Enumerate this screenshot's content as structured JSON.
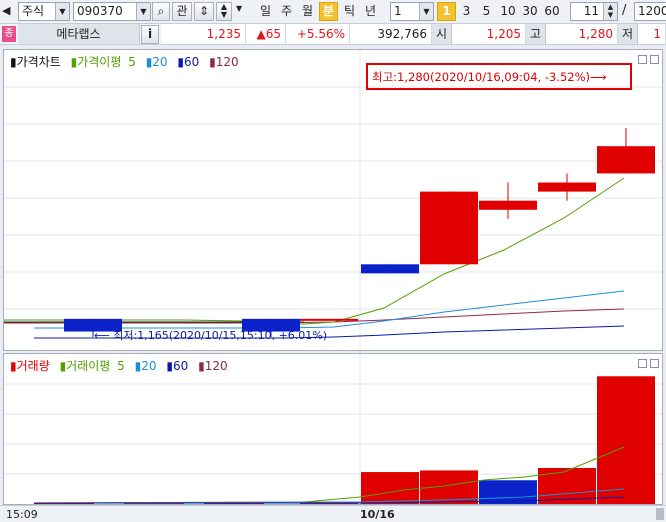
{
  "toolbar": {
    "market": "주식",
    "code": "090370",
    "search_label": "관",
    "periods": [
      "일",
      "주",
      "월",
      "분",
      "틱",
      "년"
    ],
    "active_period": "분",
    "interval_value": "1",
    "minute_options": [
      "1",
      "3",
      "5",
      "10",
      "30",
      "60"
    ],
    "active_minute": "1",
    "count_value": "11",
    "slash": "/",
    "total_count": "1200"
  },
  "info": {
    "logo_label": "종",
    "stock_name": "메타랩스",
    "info_button": "i",
    "price": "1,235",
    "change": "▲65",
    "change_pct": "+5.56%",
    "volume": "392,766",
    "open_label": "시",
    "open": "1,205",
    "high_label": "고",
    "high": "1,280",
    "low_label": "저",
    "low": "1"
  },
  "price_panel": {
    "legend_main": "가격차트",
    "legend_ma_label": "가격이평",
    "legend_periods": [
      "5",
      "20",
      "60",
      "120"
    ],
    "high_note": "최고:1,280(2020/10/16,09:04, -3.52%)⟶",
    "low_note": "⟵ 최저:1,165(2020/10/15,15:10, +6.01%)"
  },
  "volume_panel": {
    "legend_main": "거래량",
    "legend_ma_label": "거래이평",
    "legend_periods": [
      "5",
      "20",
      "60",
      "120"
    ]
  },
  "xaxis": {
    "labels": [
      "15:09",
      "10/16"
    ]
  },
  "colors": {
    "up": "#e00000",
    "down": "#0a22c8",
    "ma5": "#52a100",
    "ma20": "#1d8fd6",
    "ma60": "#0a1aa8",
    "ma120": "#8c2a4a",
    "note_border": "#e00000"
  },
  "chart_data": {
    "type": "candlestick",
    "price_candles": [
      {
        "open": 1175,
        "high": 1175,
        "low": 1165,
        "close": 1168
      },
      {
        "open": 1175,
        "high": 1175,
        "low": 1165,
        "close": 1168
      },
      {
        "open": 1175,
        "high": 1175,
        "low": 1175,
        "close": 1175
      },
      {
        "open": 1205,
        "high": 1205,
        "low": 1200,
        "close": 1200
      },
      {
        "open": 1205,
        "high": 1245,
        "low": 1205,
        "close": 1245
      },
      {
        "open": 1235,
        "high": 1250,
        "low": 1230,
        "close": 1240
      },
      {
        "open": 1245,
        "high": 1255,
        "low": 1240,
        "close": 1250
      },
      {
        "open": 1255,
        "high": 1280,
        "low": 1255,
        "close": 1270
      }
    ],
    "volume_bars": [
      {
        "value": 1000,
        "direction": "up"
      },
      {
        "value": 500,
        "direction": "up"
      },
      {
        "value": 1000,
        "direction": "up"
      },
      {
        "value": 3000,
        "direction": "up"
      },
      {
        "value": 39000,
        "direction": "up"
      },
      {
        "value": 41000,
        "direction": "up"
      },
      {
        "value": 29000,
        "direction": "down"
      },
      {
        "value": 44000,
        "direction": "up"
      },
      {
        "value": 156000,
        "direction": "up"
      }
    ]
  }
}
